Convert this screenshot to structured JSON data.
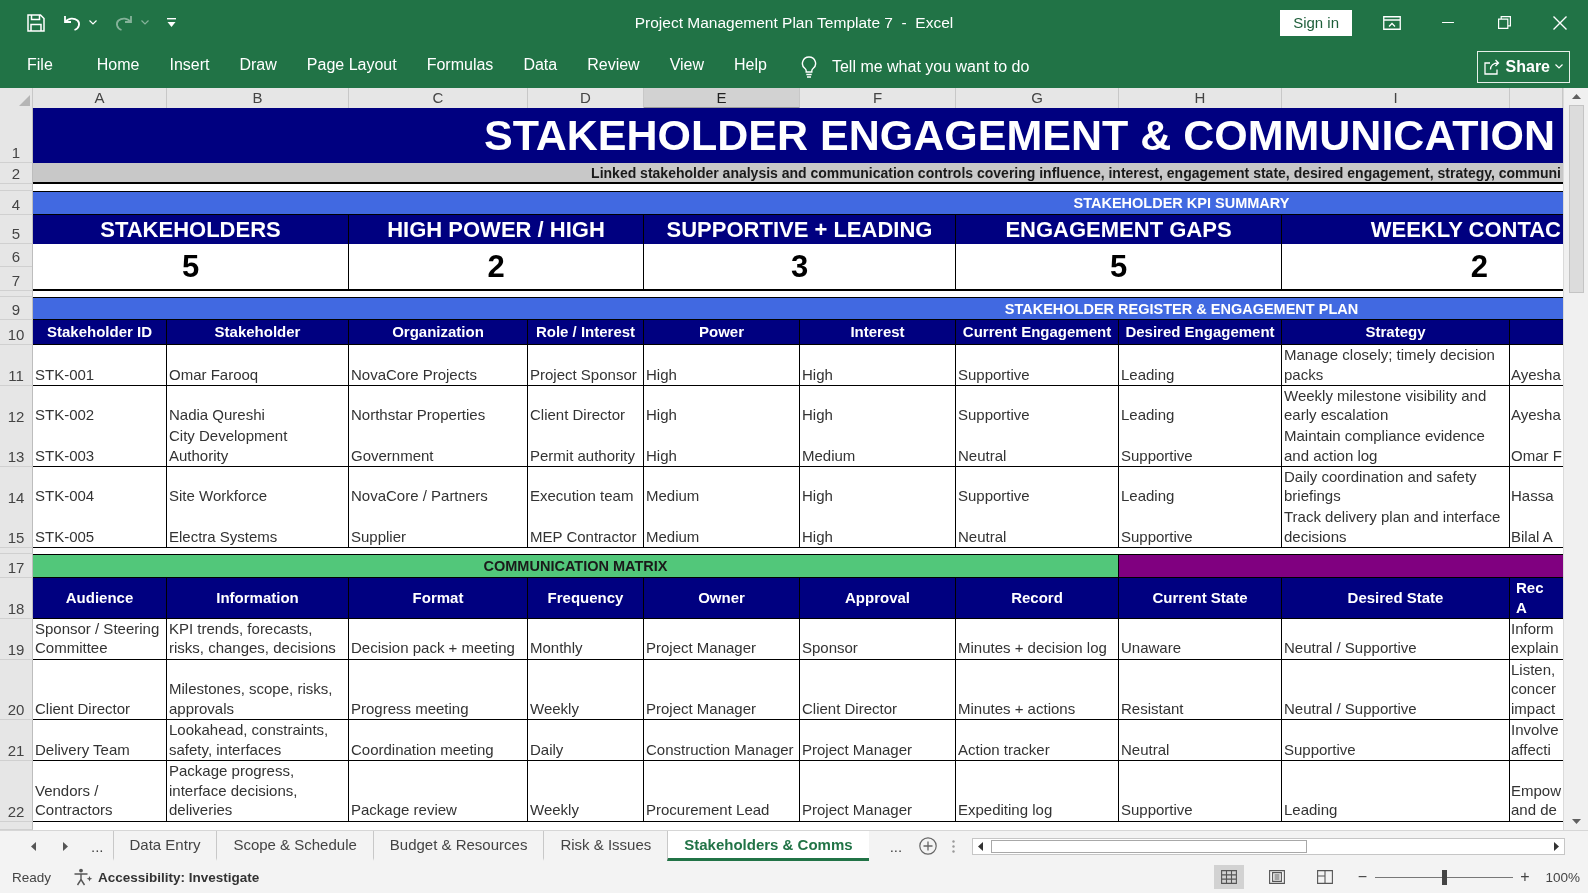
{
  "window": {
    "title": "Project Management Plan Template 7  -  Excel",
    "sign_in": "Sign in"
  },
  "quick_access": [
    {
      "kind": "save",
      "disabled": false
    },
    {
      "kind": "undo",
      "disabled": false
    },
    {
      "kind": "redo",
      "disabled": true
    },
    {
      "kind": "customize",
      "disabled": false
    }
  ],
  "ribbon": {
    "tabs": [
      {
        "label": "File",
        "selected": false
      },
      {
        "label": "Home",
        "selected": false
      },
      {
        "label": "Insert",
        "selected": false
      },
      {
        "label": "Draw",
        "selected": false
      },
      {
        "label": "Page Layout",
        "selected": false
      },
      {
        "label": "Formulas",
        "selected": false
      },
      {
        "label": "Data",
        "selected": false
      },
      {
        "label": "Review",
        "selected": false
      },
      {
        "label": "View",
        "selected": false
      },
      {
        "label": "Help",
        "selected": false
      }
    ],
    "tell_me": {
      "placeholder": "Tell me what you want to do"
    },
    "share": "Share"
  },
  "column_headers": [
    {
      "label": "A",
      "selected": false
    },
    {
      "label": "B",
      "selected": false
    },
    {
      "label": "C",
      "selected": false
    },
    {
      "label": "D",
      "selected": false
    },
    {
      "label": "E",
      "selected": true
    },
    {
      "label": "F",
      "selected": false
    },
    {
      "label": "G",
      "selected": false
    },
    {
      "label": "H",
      "selected": false
    },
    {
      "label": "I",
      "selected": false
    }
  ],
  "row_numbers": [
    "1",
    "2",
    "4",
    "5",
    "6",
    "7",
    "9",
    "10",
    "11",
    "12",
    "13",
    "14",
    "15",
    "17",
    "18",
    "19",
    "20",
    "21",
    "22"
  ],
  "sheet": {
    "title": "STAKEHOLDER ENGAGEMENT & COMMUNICATION",
    "subtitle": "Linked stakeholder analysis and communication controls covering influence, interest, engagement state, desired engagement, strategy, communi",
    "kpi_summary": {
      "title": "STAKEHOLDER KPI SUMMARY",
      "kpis": [
        {
          "label": "STAKEHOLDERS",
          "value": "5"
        },
        {
          "label": "HIGH POWER / HIGH",
          "value": "2"
        },
        {
          "label": "SUPPORTIVE + LEADING",
          "value": "3"
        },
        {
          "label": "ENGAGEMENT GAPS",
          "value": "5"
        },
        {
          "label": "WEEKLY CONTAC",
          "value": "2"
        }
      ]
    },
    "register": {
      "title": "STAKEHOLDER REGISTER & ENGAGEMENT PLAN",
      "columns": [
        "Stakeholder ID",
        "Stakeholder",
        "Organization",
        "Role / Interest",
        "Power",
        "Interest",
        "Current Engagement",
        "Desired Engagement",
        "Strategy"
      ],
      "rows": [
        [
          "STK-001",
          "Omar Farooq",
          "NovaCore Projects",
          "Project Sponsor",
          "High",
          "High",
          "Supportive",
          "Leading",
          "Manage closely; timely decision packs",
          "Ayesha"
        ],
        [
          "STK-002",
          "Nadia Qureshi",
          "Northstar Properties",
          "Client Director",
          "High",
          "High",
          "Supportive",
          "Leading",
          "Weekly milestone visibility and early escalation",
          "Ayesha"
        ],
        [
          "STK-003",
          "City Development Authority",
          "Government",
          "Permit authority",
          "High",
          "Medium",
          "Neutral",
          "Supportive",
          "Maintain compliance evidence and action log",
          "Omar F"
        ],
        [
          "STK-004",
          "Site Workforce",
          "NovaCore / Partners",
          "Execution team",
          "Medium",
          "High",
          "Supportive",
          "Leading",
          "Daily coordination and safety briefings",
          "Hassa"
        ],
        [
          "STK-005",
          "Electra Systems",
          "Supplier",
          "MEP Contractor",
          "Medium",
          "High",
          "Neutral",
          "Supportive",
          "Track delivery plan and interface decisions",
          "Bilal A"
        ]
      ]
    },
    "communication_matrix": {
      "title": "COMMUNICATION MATRIX",
      "columns": [
        "Audience",
        "Information",
        "Format",
        "Frequency",
        "Owner",
        "Approval",
        "Record",
        "Current State",
        "Desired State",
        "Rec\nA"
      ],
      "rows": [
        [
          "Sponsor / Steering Committee",
          "KPI trends, forecasts, risks, changes, decisions",
          "Decision pack + meeting",
          "Monthly",
          "Project Manager",
          "Sponsor",
          "Minutes + decision log",
          "Unaware",
          "Neutral / Supportive",
          "Inform\nexplain"
        ],
        [
          "Client Director",
          "Milestones, scope, risks, approvals",
          "Progress meeting",
          "Weekly",
          "Project Manager",
          "Client Director",
          "Minutes + actions",
          "Resistant",
          "Neutral / Supportive",
          "Listen,\nconcer\nimpact"
        ],
        [
          "Delivery Team",
          "Lookahead, constraints, safety, interfaces",
          "Coordination meeting",
          "Daily",
          "Construction Manager",
          "Project Manager",
          "Action tracker",
          "Neutral",
          "Supportive",
          "Involve\naffecti"
        ],
        [
          "Vendors / Contractors",
          "Package progress, interface decisions, deliveries",
          "Package review",
          "Weekly",
          "Procurement Lead",
          "Project Manager",
          "Expediting log",
          "Supportive",
          "Leading",
          "Empow\nand de"
        ]
      ]
    }
  },
  "sheet_tabs": {
    "more_left": "...",
    "tabs": [
      {
        "label": "Data Entry",
        "selected": false
      },
      {
        "label": "Scope & Schedule",
        "selected": false
      },
      {
        "label": "Budget & Resources",
        "selected": false
      },
      {
        "label": "Risk & Issues",
        "selected": false
      },
      {
        "label": "Stakeholders & Comms",
        "selected": true
      }
    ],
    "more_right": "..."
  },
  "status_bar": {
    "status": "Ready",
    "accessibility": "Accessibility: Investigate",
    "view_buttons": [
      {
        "kind": "normal",
        "selected": true
      },
      {
        "kind": "page_layout",
        "selected": false
      },
      {
        "kind": "page_break",
        "selected": false
      }
    ],
    "zoom": {
      "minus": "−",
      "plus": "+",
      "level": 0.5,
      "reading": "100%"
    }
  }
}
